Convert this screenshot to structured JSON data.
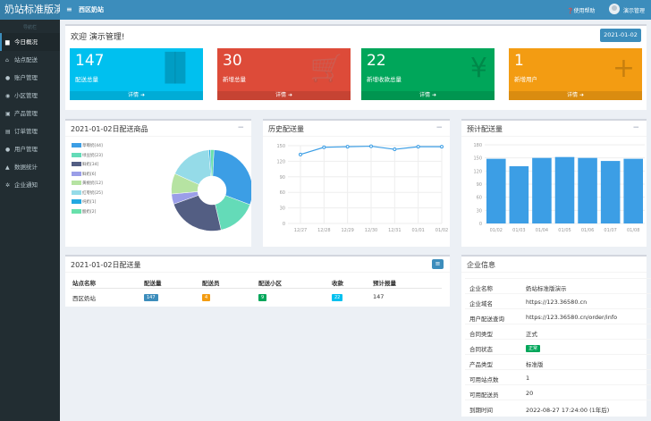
{
  "app": {
    "brand": "奶站标准版演",
    "sidebar_caption": "导航栏"
  },
  "sidebar": {
    "items": [
      {
        "label": "今日概况",
        "icon": "dashboard-icon",
        "glyph": "▆"
      },
      {
        "label": "站点配送",
        "icon": "home-icon",
        "glyph": "⌂"
      },
      {
        "label": "账户管理",
        "icon": "user-icon",
        "glyph": "●"
      },
      {
        "label": "小区管理",
        "icon": "map-marker-icon",
        "glyph": "◉"
      },
      {
        "label": "产品管理",
        "icon": "product-icon",
        "glyph": "▣"
      },
      {
        "label": "订单管理",
        "icon": "order-icon",
        "glyph": "▤"
      },
      {
        "label": "用户管理",
        "icon": "users-icon",
        "glyph": "●"
      },
      {
        "label": "数据统计",
        "icon": "chart-icon",
        "glyph": "▲"
      },
      {
        "label": "企业通知",
        "icon": "gear-icon",
        "glyph": "✲"
      }
    ]
  },
  "header": {
    "menu_glyph": "≡",
    "title": "西区奶站",
    "help": "使用帮助",
    "user": "演示管理"
  },
  "welcome": {
    "title": "欢迎 演示管理!",
    "date": "2021-01-02"
  },
  "stats": [
    {
      "value": "147",
      "label": "配送总量",
      "more": "详情",
      "color": "#00c0ef",
      "icon": "bar-chart-icon",
      "glyph": "▐▌"
    },
    {
      "value": "30",
      "label": "新增总量",
      "more": "详情",
      "color": "#dd4b39",
      "icon": "cart-icon",
      "glyph": "🛒"
    },
    {
      "value": "22",
      "label": "新增收款总量",
      "more": "详情",
      "color": "#00a65a",
      "icon": "yen-icon",
      "glyph": "¥"
    },
    {
      "value": "1",
      "label": "新增用户",
      "more": "详情",
      "color": "#f39c12",
      "icon": "user-plus-icon",
      "glyph": "+"
    }
  ],
  "pie_box": {
    "title": "2021-01-02日配送商品",
    "minimize": "−"
  },
  "history_box": {
    "title": "历史配送量",
    "minimize": "−"
  },
  "forecast_box": {
    "title": "预计配送量",
    "minimize": "−"
  },
  "table_box": {
    "title": "2021-01-02日配送量",
    "columns": [
      "站点名称",
      "配送量",
      "配送员",
      "配送小区",
      "收款",
      "预计报量"
    ],
    "rows": [
      {
        "site": "西区奶站",
        "delivery": "147",
        "couriers": "4",
        "communities": "9",
        "payments": "22",
        "forecast": "147"
      }
    ]
  },
  "company": {
    "title": "企业信息",
    "rows": [
      {
        "k": "企业名称",
        "v": "奶站标准版演示"
      },
      {
        "k": "企业域名",
        "v": "https://123.36580.cn"
      },
      {
        "k": "用户配送查询",
        "v": "https://123.36580.cn/order/info"
      },
      {
        "k": "合同类型",
        "v": "正式"
      },
      {
        "k": "合同状态",
        "v": "正常"
      },
      {
        "k": "产品类型",
        "v": "标准版"
      },
      {
        "k": "可用站点数",
        "v": "1"
      },
      {
        "k": "可用配送员",
        "v": "20"
      },
      {
        "k": "到期时间",
        "v": "2022-08-27 17:24:00 (1年后)"
      }
    ]
  },
  "chart_data": [
    {
      "type": "pie",
      "title": "2021-01-02日配送商品",
      "legend": "left",
      "slices": [
        {
          "name": "草莓奶[44]",
          "value": 44,
          "color": "#3c9ee5"
        },
        {
          "name": "绿豆奶[23]",
          "value": 23,
          "color": "#64dbb8"
        },
        {
          "name": "鲜奶[34]",
          "value": 34,
          "color": "#535e83"
        },
        {
          "name": "鲜奶[6]",
          "value": 6,
          "color": "#9b9ee8"
        },
        {
          "name": "黄桃奶[12]",
          "value": 12,
          "color": "#b6e3a2"
        },
        {
          "name": "红枣奶[25]",
          "value": 25,
          "color": "#95dbe8"
        },
        {
          "name": "纯奶[1]",
          "value": 1,
          "color": "#22a8e1"
        },
        {
          "name": "酸奶[2]",
          "value": 2,
          "color": "#68e0ab"
        }
      ]
    },
    {
      "type": "line",
      "title": "历史配送量",
      "categories": [
        "12/27",
        "12/28",
        "12/29",
        "12/30",
        "12/31",
        "01/01",
        "01/02"
      ],
      "values": [
        133,
        147,
        148,
        149,
        143,
        148,
        148
      ],
      "ylim": [
        0,
        150
      ],
      "yticks": [
        0,
        30,
        60,
        90,
        120,
        150
      ],
      "grid": true
    },
    {
      "type": "bar",
      "title": "预计配送量",
      "categories": [
        "01/02",
        "01/03",
        "01/04",
        "01/05",
        "01/06",
        "01/07",
        "01/08"
      ],
      "values": [
        148,
        131,
        150,
        152,
        150,
        143,
        148
      ],
      "ylim": [
        0,
        180
      ],
      "yticks": [
        0,
        30,
        60,
        90,
        120,
        150,
        180
      ],
      "grid": true
    }
  ]
}
